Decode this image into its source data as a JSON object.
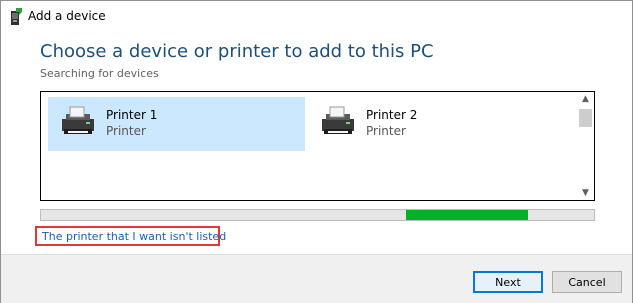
{
  "window": {
    "title": "Add a device",
    "icon": "add-device-icon"
  },
  "main": {
    "heading": "Choose a device or printer to add to this PC",
    "status": "Searching for devices",
    "devices": [
      {
        "name": "Printer 1",
        "type": "Printer",
        "icon": "printer-icon",
        "selected": true
      },
      {
        "name": "Printer 2",
        "type": "Printer",
        "icon": "printer-icon",
        "selected": false
      }
    ],
    "progress": {
      "segment_start": 0.66,
      "segment_end": 0.88,
      "color": "#06b025"
    },
    "not_listed_link": "The printer that I want isn't listed",
    "highlight_color": "#e03838"
  },
  "footer": {
    "next_label": "Next",
    "cancel_label": "Cancel"
  },
  "colors": {
    "heading": "#1f4e79",
    "selection": "#cce8ff",
    "accent": "#0078d7"
  }
}
